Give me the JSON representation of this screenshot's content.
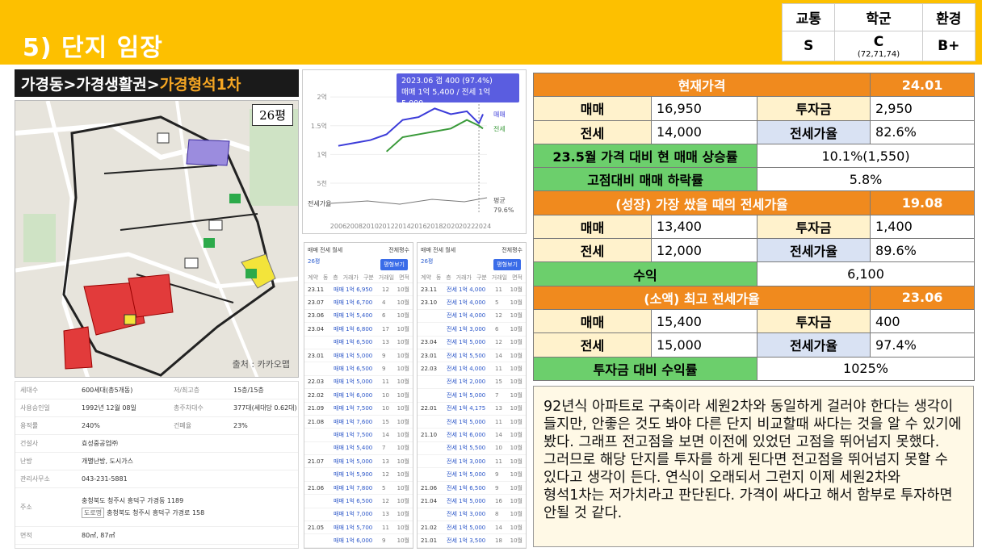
{
  "header": {
    "title": "5) 단지 임장",
    "bg_color": "#fdc000"
  },
  "grades": {
    "traffic_label": "교통",
    "school_label": "학군",
    "env_label": "환경",
    "traffic": "S",
    "school": "C",
    "school_detail": "(72,71,74)",
    "env": "B+"
  },
  "breadcrumb": {
    "part1": "가경동>가경생활권>",
    "part2": "가경형석1차"
  },
  "map": {
    "pyeong": "26평",
    "credit": "출처 : 카카오맵"
  },
  "info": {
    "households_label": "세대수",
    "households": "600세대(총5개동)",
    "floors_label": "저/최고층",
    "floors": "15층/15층",
    "approval_label": "사용승인일",
    "approval": "1992년 12월 08일",
    "parking_label": "총주차대수",
    "parking": "377대(세대당 0.62대)",
    "far_label": "용적률",
    "far": "240%",
    "bcr_label": "건폐율",
    "bcr": "23%",
    "builder_label": "건설사",
    "builder": "효성중공업㈜",
    "heating_label": "난방",
    "heating": "개별난방, 도시가스",
    "office_label": "관리사무소",
    "office": "043-231-5881",
    "address_label": "주소",
    "address": "충청북도 청주시 흥덕구 가경동 1189",
    "road_tag": "도로명",
    "road_address": "충청북도 청주시 흥덕구 가경로 158",
    "area_label": "면적",
    "area": "80㎡, 87㎡"
  },
  "graph": {
    "tooltip_line1": "2023.06 갭 400 (97.4%)",
    "tooltip_line2": "매매 1억 5,400 / 전세 1억 5,000",
    "y_ticks": [
      "2억",
      "1.5억",
      "1억",
      "5천"
    ],
    "x_ticks": [
      "2006",
      "2008",
      "2010",
      "2012",
      "2014",
      "2016",
      "2018",
      "2020",
      "2022",
      "2024"
    ],
    "legend_sale": "매매",
    "legend_jeonse": "전세",
    "ratio_label": "전세가율",
    "legend_ratio": "평균",
    "ratio_value": "79.6%"
  },
  "chart_data": {
    "type": "line",
    "x": [
      2006,
      2008,
      2010,
      2012,
      2014,
      2016,
      2018,
      2020,
      2022,
      2023.5,
      2024
    ],
    "series": [
      {
        "name": "매매",
        "values": [
          1.15,
          1.2,
          1.25,
          1.35,
          1.6,
          1.65,
          1.8,
          1.7,
          1.75,
          1.54,
          1.7
        ]
      },
      {
        "name": "전세",
        "values": [
          null,
          null,
          null,
          1.05,
          1.3,
          1.35,
          1.4,
          1.45,
          1.6,
          1.5,
          1.45
        ]
      }
    ],
    "ylim": [
      0.5,
      2.1
    ],
    "color_sale": "#3b3bd9",
    "color_jeonse": "#3a9a3a"
  },
  "tx_left": {
    "tab1": "매매",
    "tab2": "전세",
    "tab3": "월세",
    "filter": "전체평수",
    "sub": "26평",
    "btn": "평형보기",
    "cols": [
      "계약",
      "동",
      "층",
      "거래가",
      "구분",
      "거래일",
      "면적"
    ],
    "rows": [
      [
        "23.11",
        "매매 1억 6,950",
        "12",
        "10월"
      ],
      [
        "23.07",
        "매매 1억 6,700",
        "4",
        "10월"
      ],
      [
        "23.06",
        "매매 1억 5,400",
        "6",
        "10월"
      ],
      [
        "23.04",
        "매매 1억 6,800",
        "17",
        "10월"
      ],
      [
        "",
        "매매 1억 6,500",
        "13",
        "10월"
      ],
      [
        "23.01",
        "매매 1억 5,000",
        "9",
        "10월"
      ],
      [
        "",
        "매매 1억 6,500",
        "9",
        "10월"
      ],
      [
        "22.03",
        "매매 1억 5,000",
        "11",
        "10월"
      ],
      [
        "22.02",
        "매매 1억 6,000",
        "10",
        "10월"
      ],
      [
        "21.09",
        "매매 1억 7,500",
        "10",
        "10월"
      ],
      [
        "21.08",
        "매매 1억 7,600",
        "15",
        "10월"
      ],
      [
        "",
        "매매 1억 7,500",
        "14",
        "10월"
      ],
      [
        "",
        "매매 1억 5,400",
        "7",
        "10월"
      ],
      [
        "21.07",
        "매매 1억 5,000",
        "13",
        "10월"
      ],
      [
        "",
        "매매 1억 5,900",
        "12",
        "10월"
      ],
      [
        "21.06",
        "매매 1억 7,800",
        "5",
        "10월"
      ],
      [
        "",
        "매매 1억 6,500",
        "12",
        "10월"
      ],
      [
        "",
        "매매 1억 7,000",
        "13",
        "10월"
      ],
      [
        "21.05",
        "매매 1억 5,700",
        "11",
        "10월"
      ],
      [
        "",
        "매매 1억 6,000",
        "9",
        "10월"
      ]
    ]
  },
  "tx_right": {
    "tab1": "매매",
    "tab2": "전세",
    "tab3": "월세",
    "filter": "전체평수",
    "sub": "26평",
    "btn": "평형보기",
    "cols": [
      "계약",
      "동",
      "층",
      "거래가",
      "구분",
      "거래일",
      "면적"
    ],
    "rows": [
      [
        "23.11",
        "전세 1억 4,000",
        "11",
        "10월"
      ],
      [
        "23.10",
        "전세 1억 4,000",
        "5",
        "10월"
      ],
      [
        "",
        "전세 1억 4,000",
        "12",
        "10월"
      ],
      [
        "",
        "전세 1억 3,000",
        "6",
        "10월"
      ],
      [
        "23.04",
        "전세 1억 5,000",
        "12",
        "10월"
      ],
      [
        "23.01",
        "전세 1억 5,500",
        "14",
        "10월"
      ],
      [
        "22.03",
        "전세 1억 4,000",
        "11",
        "10월"
      ],
      [
        "",
        "전세 1억 2,000",
        "15",
        "10월"
      ],
      [
        "",
        "전세 1억 5,000",
        "7",
        "10월"
      ],
      [
        "22.01",
        "전세 1억 4,175",
        "13",
        "10월"
      ],
      [
        "",
        "전세 1억 5,000",
        "11",
        "10월"
      ],
      [
        "21.10",
        "전세 1억 6,000",
        "14",
        "10월"
      ],
      [
        "",
        "전세 1억 5,500",
        "10",
        "10월"
      ],
      [
        "",
        "전세 1억 3,000",
        "11",
        "10월"
      ],
      [
        "",
        "전세 1억 5,000",
        "9",
        "10월"
      ],
      [
        "21.06",
        "전세 1억 6,500",
        "9",
        "10월"
      ],
      [
        "21.04",
        "전세 1억 5,000",
        "16",
        "10월"
      ],
      [
        "",
        "전세 1억 3,000",
        "8",
        "10월"
      ],
      [
        "21.02",
        "전세 1억 5,000",
        "14",
        "10월"
      ],
      [
        "21.01",
        "전세 1억 3,500",
        "18",
        "10월"
      ]
    ]
  },
  "price": {
    "current_label": "현재가격",
    "current_date": "24.01",
    "sale_label": "매매",
    "jeonse_label": "전세",
    "invest_label": "투자금",
    "ratio_label": "전세가율",
    "cur_sale": "16,950",
    "cur_invest": "2,950",
    "cur_jeonse": "14,000",
    "cur_ratio": "82.6%",
    "rise_label": "23.5월 가격 대비 현 매매 상승률",
    "rise": "10.1%(1,550)",
    "drop_label": "고점대비 매매 하락률",
    "drop": "5.8%",
    "grow_label": "(성장) 가장 쌌을 때의 전세가율",
    "grow_date": "19.08",
    "grow_sale": "13,400",
    "grow_invest": "1,400",
    "grow_jeonse": "12,000",
    "grow_ratio": "89.6%",
    "profit_label": "수익",
    "profit": "6,100",
    "small_label": "(소액) 최고 전세가율",
    "small_date": "23.06",
    "small_sale": "15,400",
    "small_invest": "400",
    "small_jeonse": "15,000",
    "small_ratio": "97.4%",
    "roi_label": "투자금 대비 수익률",
    "roi": "1025%"
  },
  "note": "92년식 아파트로 구축이라 세원2차와 동일하게 걸러야 한다는 생각이 들지만, 안좋은 것도 봐야 다른 단지 비교할때 싸다는 것을 알 수 있기에 봤다. 그래프 전고점을 보면 이전에 있었던 고점을 뛰어넘지 못했다. 그러므로 해당 단지를 투자를 하게 된다면 전고점을 뛰어넘지 못할 수 있다고 생각이 든다. 연식이 오래되서 그런지 이제 세원2차와 형석1차는 저가치라고 판단된다. 가격이 싸다고 해서 함부로 투자하면 안될 것 같다."
}
